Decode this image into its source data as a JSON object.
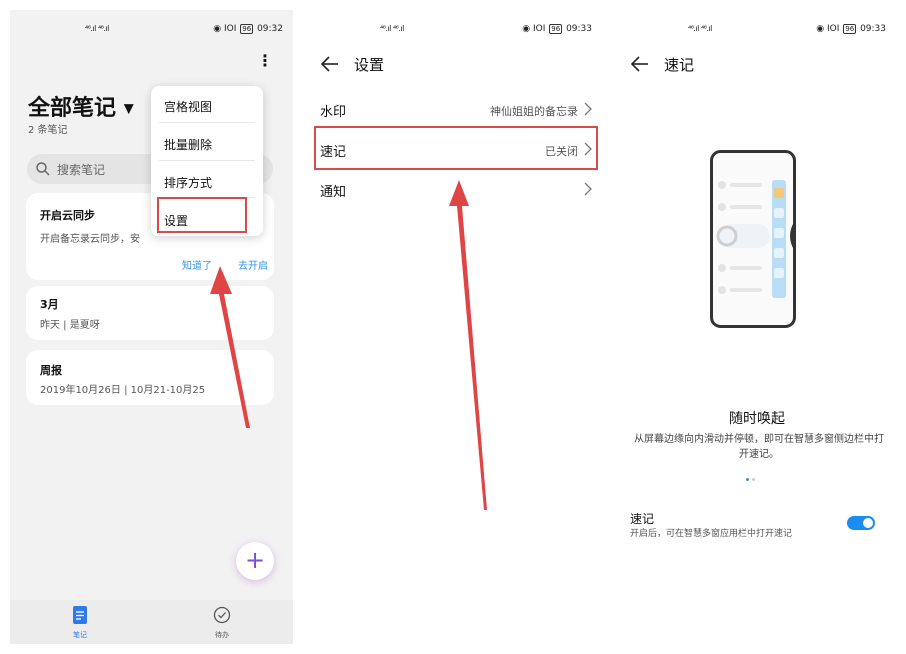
{
  "colors": {
    "highlight_red": "#d94a4a",
    "accent_blue": "#2e95e8",
    "toggle_on": "#1d8cf0",
    "fab_purple": "#7a4fd4"
  },
  "screen1": {
    "status": {
      "signal": "⁣⁣⁴⁶.ıl ⁴⁶.ıl",
      "icons": "◉ IOI",
      "battery": "96",
      "time": "09:32"
    },
    "title": "全部笔记",
    "count": "2 条笔记",
    "search_placeholder": "搜索笔记",
    "cards": {
      "sync": {
        "title": "开启云同步",
        "text": "开启备忘录云同步，安",
        "dismiss": "知道了",
        "enable": "去开启"
      },
      "march": {
        "title": "3月",
        "meta": "昨天 | 是夏呀"
      },
      "weekly": {
        "title": "周报",
        "meta": "2019年10月26日 | 10月21-10月25"
      }
    },
    "menu": {
      "items": [
        "宫格视图",
        "批量删除",
        "排序方式",
        "设置"
      ]
    },
    "nav": {
      "notes": "笔记",
      "todo": "待办"
    },
    "fab": "+"
  },
  "screen2": {
    "status": {
      "signal": "⁴⁶.ıl ⁴⁶.ıl",
      "icons": "◉ IOI",
      "battery": "96",
      "time": "09:33"
    },
    "title": "设置",
    "rows": [
      {
        "label": "水印",
        "value": "神仙姐姐的备忘录"
      },
      {
        "label": "速记",
        "value": "已关闭"
      },
      {
        "label": "通知",
        "value": ""
      }
    ]
  },
  "screen3": {
    "status": {
      "signal": "⁴⁶.ıl ⁴⁶.ıl",
      "icons": "◉ IOI",
      "battery": "96",
      "time": "09:33"
    },
    "title": "速记",
    "slogan_title": "随时唤起",
    "slogan_desc": "从屏幕边缘向内滑动并停顿，即可在智慧多窗侧边栏中打开速记。",
    "toggle_label": "速记",
    "toggle_desc": "开启后，可在智慧多窗应用栏中打开速记",
    "toggle_on": true,
    "carousel": {
      "active": 1,
      "total": 2
    }
  }
}
